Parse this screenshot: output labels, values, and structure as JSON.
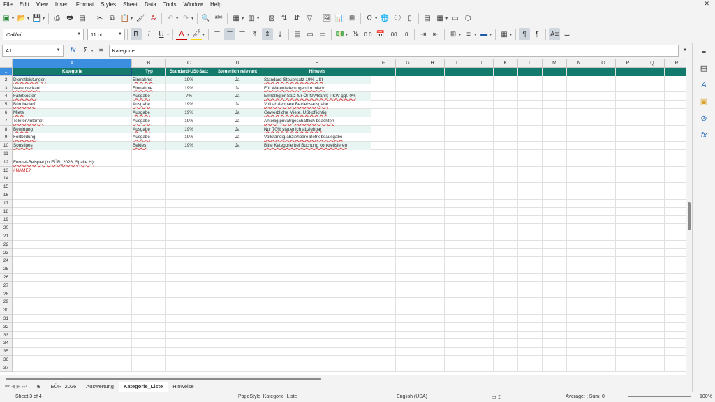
{
  "menu": [
    "File",
    "Edit",
    "View",
    "Insert",
    "Format",
    "Styles",
    "Sheet",
    "Data",
    "Tools",
    "Window",
    "Help"
  ],
  "font_name": "Calibri",
  "font_size": "11 pt",
  "name_box": "A1",
  "formula": "Kategorie",
  "columns": [
    "A",
    "B",
    "C",
    "D",
    "E",
    "F",
    "G",
    "H",
    "I",
    "J",
    "K",
    "L",
    "M",
    "N",
    "O",
    "P",
    "Q",
    "R"
  ],
  "header": [
    "Kategorie",
    "Typ",
    "Standard-USt-Satz",
    "Steuerlich relevant",
    "Hinweis"
  ],
  "rows": [
    [
      "Dienstleistungen",
      "Einnahme",
      "19%",
      "Ja",
      "Standard-Steuersatz 19% USt"
    ],
    [
      "Warenverkauf",
      "Einnahme",
      "19%",
      "Ja",
      "Für Warenlieferungen im Inland"
    ],
    [
      "Fahrtkosten",
      "Ausgabe",
      "7%",
      "Ja",
      "Ermäßigter Satz für ÖPNV/Bahn; PKW ggf. 0%"
    ],
    [
      "Bürobedarf",
      "Ausgabe",
      "19%",
      "Ja",
      "Voll abziehbare Betriebsausgabe"
    ],
    [
      "Miete",
      "Ausgabe",
      "19%",
      "Ja",
      "Gewerbliche Miete, USt-pflichtig"
    ],
    [
      "Telefon/Internet",
      "Ausgabe",
      "19%",
      "Ja",
      "Anteilig privat/geschäftlich beachten"
    ],
    [
      "Bewirtung",
      "Ausgabe",
      "19%",
      "Ja",
      "Nur 70% steuerlich abziehbar"
    ],
    [
      "Fortbildung",
      "Ausgabe",
      "19%",
      "Ja",
      "Vollständig abziehbare Betriebsausgabe"
    ],
    [
      "Sonstiges",
      "Beides",
      "19%",
      "Ja",
      "Bitte Kategorie bei Buchung konkretisieren"
    ]
  ],
  "note": "Formel-Beispiel (in EÜR_2026, Spalte H):",
  "error": "#NAME?",
  "tabs": [
    "EÜR_2026",
    "Auswertung",
    "Kategorie_Liste",
    "Hinweise"
  ],
  "status": {
    "sheet": "Sheet 3 of 4",
    "style": "PageStyle_Kategorie_Liste",
    "lang": "English (USA)",
    "sum": "Average: ; Sum: 0",
    "zoom": "100%"
  }
}
